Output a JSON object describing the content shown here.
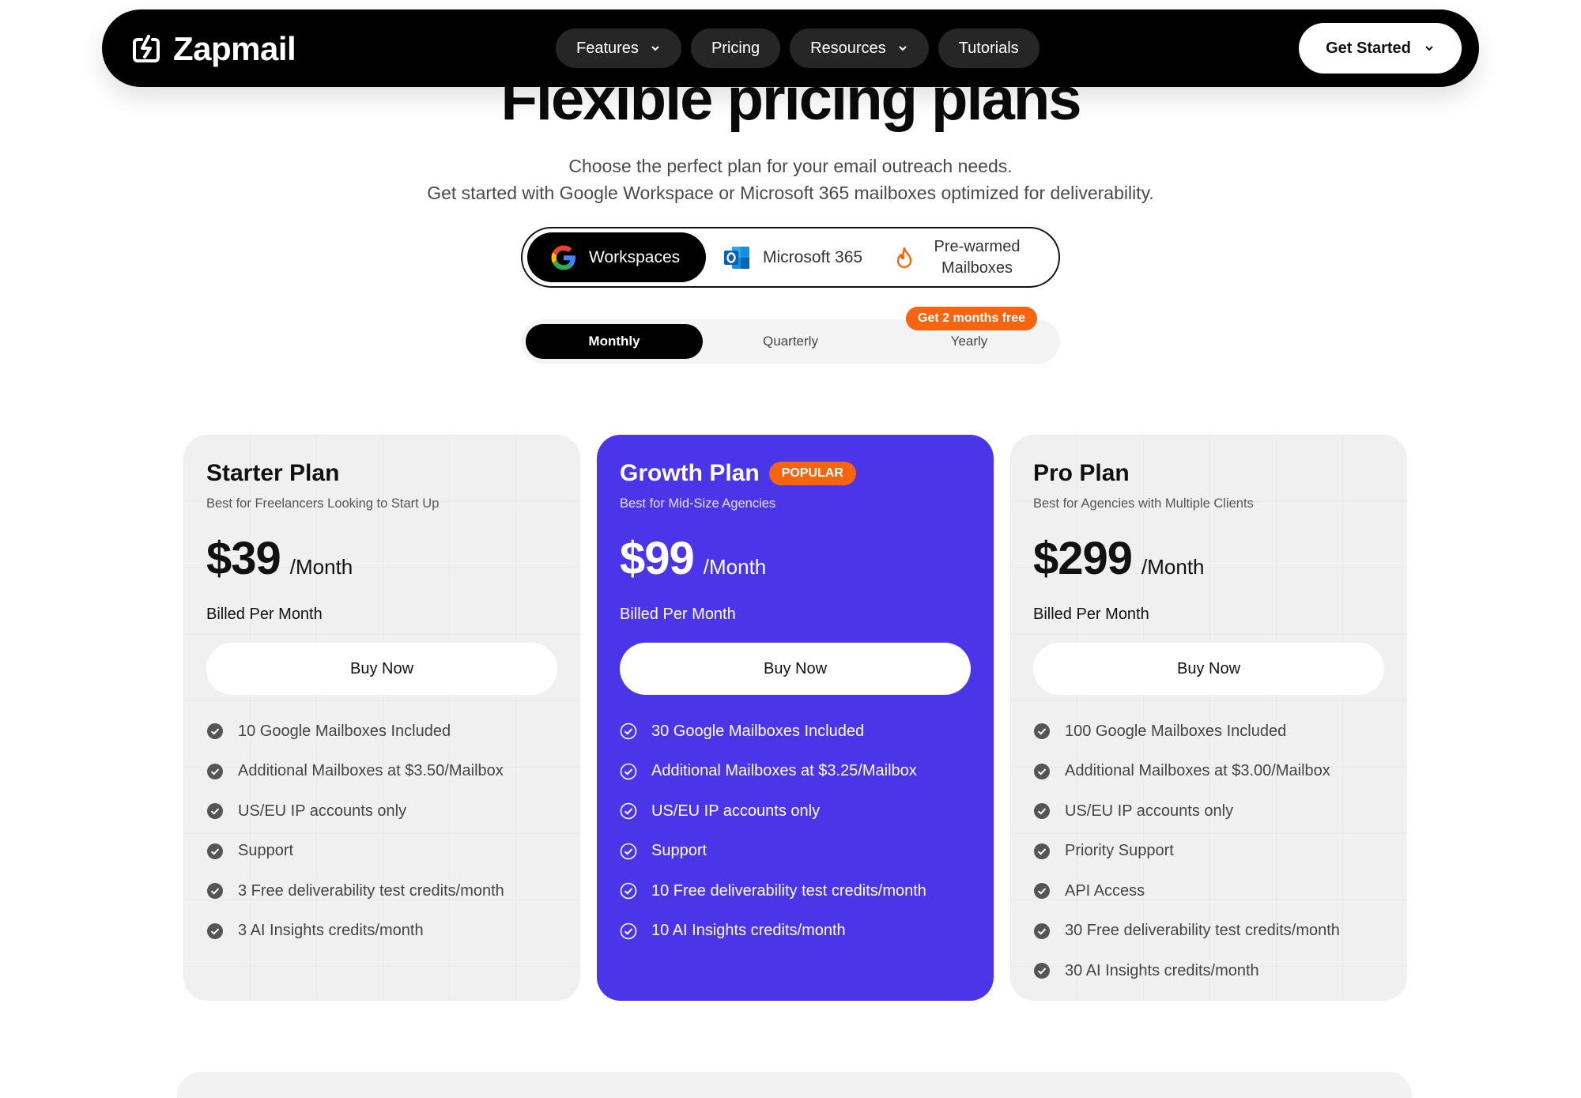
{
  "nav": {
    "brand": "Zapmail",
    "links": [
      {
        "label": "Features",
        "has_dropdown": true
      },
      {
        "label": "Pricing",
        "has_dropdown": false
      },
      {
        "label": "Resources",
        "has_dropdown": true
      },
      {
        "label": "Tutorials",
        "has_dropdown": false
      }
    ],
    "cta": "Get Started"
  },
  "hero": {
    "title": "Flexible pricing plans",
    "subtitle_line1": "Choose the perfect plan for your email outreach needs.",
    "subtitle_line2": "Get started with Google Workspace or Microsoft 365 mailboxes optimized for deliverability."
  },
  "provider_toggle": {
    "options": [
      {
        "label": "Workspaces",
        "icon": "google-icon",
        "selected": true
      },
      {
        "label": "Microsoft 365",
        "icon": "outlook-icon",
        "selected": false
      },
      {
        "label_line1": "Pre-warmed",
        "label_line2": "Mailboxes",
        "icon": "flame-icon",
        "selected": false
      }
    ]
  },
  "billing_toggle": {
    "options": [
      "Monthly",
      "Quarterly",
      "Yearly"
    ],
    "selected": "Monthly",
    "yearly_badge": "Get 2 months free"
  },
  "plans": [
    {
      "name": "Starter Plan",
      "description": "Best for Freelancers Looking to Start Up",
      "price": "$39",
      "period": "/Month",
      "billed": "Billed Per Month",
      "cta": "Buy Now",
      "features": [
        "10 Google Mailboxes Included",
        "Additional Mailboxes at $3.50/Mailbox",
        "US/EU IP accounts only",
        "Support",
        "3 Free deliverability test credits/month",
        "3 AI Insights credits/month"
      ]
    },
    {
      "name": "Growth Plan",
      "badge": "POPULAR",
      "description": "Best for Mid-Size Agencies",
      "price": "$99",
      "period": "/Month",
      "billed": "Billed Per Month",
      "cta": "Buy Now",
      "features": [
        "30 Google Mailboxes Included",
        "Additional Mailboxes at $3.25/Mailbox",
        "US/EU IP accounts only",
        "Support",
        "10 Free deliverability test credits/month",
        "10 AI Insights credits/month"
      ]
    },
    {
      "name": "Pro Plan",
      "description": "Best for Agencies with Multiple Clients",
      "price": "$299",
      "period": "/Month",
      "billed": "Billed Per Month",
      "cta": "Buy Now",
      "features": [
        "100 Google Mailboxes Included",
        "Additional Mailboxes at $3.00/Mailbox",
        "US/EU IP accounts only",
        "Priority Support",
        "API Access",
        "30 Free deliverability test credits/month",
        "30 AI Insights credits/month"
      ]
    }
  ],
  "colors": {
    "accent": "#4a35e8",
    "badge": "#f5650f",
    "nav_bg": "#000000"
  }
}
